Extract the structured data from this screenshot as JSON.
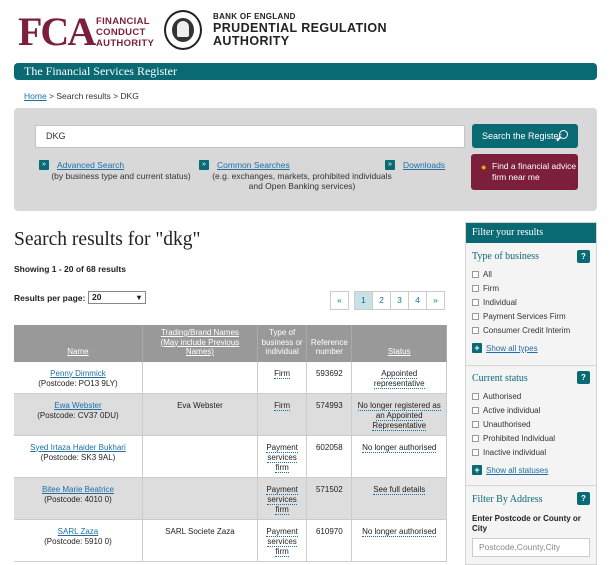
{
  "header": {
    "fca_letters": "FCA",
    "fca_line1": "FINANCIAL",
    "fca_line2": "CONDUCT",
    "fca_line3": "AUTHORITY",
    "boe_small": "BANK OF ENGLAND",
    "boe_line1": "PRUDENTIAL REGULATION",
    "boe_line2": "AUTHORITY"
  },
  "banner": "The Financial Services Register",
  "breadcrumb": {
    "home": "Home",
    "rest": " > Search results > DKG"
  },
  "search": {
    "value": "DKG",
    "button": "Search the Register",
    "advice_line1": "Find a financial advice",
    "advice_line2": "firm near me",
    "advanced_label": "Advanced Search",
    "advanced_sub": "(by business type and current status)",
    "common_label": "Common Searches",
    "common_sub1": "(e.g. exchanges, markets, prohibited individuals",
    "common_sub2": "and Open Banking services)",
    "downloads_label": "Downloads"
  },
  "results": {
    "title": "Search results for \"dkg\"",
    "showing": "Showing 1 - 20 of 68 results",
    "per_page_label": "Results per page:",
    "per_page_value": "20",
    "pager": [
      "«",
      "1",
      "2",
      "3",
      "4",
      "»"
    ]
  },
  "table": {
    "headers": {
      "name": "Name",
      "trading1": "Trading/Brand Names",
      "trading2": "(May include Previous",
      "trading3": "Names)",
      "type1": "Type of",
      "type2": "business or",
      "type3": "individual",
      "ref1": "Reference",
      "ref2": "number",
      "status": "Status"
    },
    "rows": [
      {
        "name": "Penny Dimmick",
        "postcode": "(Postcode: PO13 9LY)",
        "trading": "",
        "type": "Firm",
        "ref": "593692",
        "status": "Appointed representative"
      },
      {
        "name": "Ewa Webster",
        "postcode": "(Postcode: CV37 0DU)",
        "trading": "Eva Webster",
        "type": "Firm",
        "ref": "574993",
        "status": "No longer registered as an Appointed Representative"
      },
      {
        "name": "Syed Irtaza Haider Bukhari",
        "postcode": "(Postcode: SK3 9AL)",
        "trading": "",
        "type": "Payment services firm",
        "ref": "602058",
        "status": "No longer authorised"
      },
      {
        "name": "Bitee Marie Beatrice",
        "postcode": "(Postcode: 4010 0)",
        "trading": "",
        "type": "Payment services firm",
        "ref": "571502",
        "status": "See full details"
      },
      {
        "name": "SARL Zaza",
        "postcode": "(Postcode: 5910 0)",
        "trading": "SARL Societe Zaza",
        "type": "Payment services firm",
        "ref": "610970",
        "status": "No longer authorised"
      }
    ]
  },
  "sidebar": {
    "header": "Filter your results",
    "type_title": "Type of business",
    "type_items": [
      "All",
      "Firm",
      "Individual",
      "Payment Services Firm",
      "Consumer Credit Interim"
    ],
    "show_types": "Show all types",
    "status_title": "Current status",
    "status_items": [
      "Authorised",
      "Active individual",
      "Unauthorised",
      "Prohibited Individual",
      "Inactive individual"
    ],
    "show_statuses": "Show all statuses",
    "address_title": "Filter By Address",
    "address_label1": "Enter Postcode or County or",
    "address_label2": "City",
    "address_placeholder": "Postcode,County,City",
    "help": "?"
  }
}
